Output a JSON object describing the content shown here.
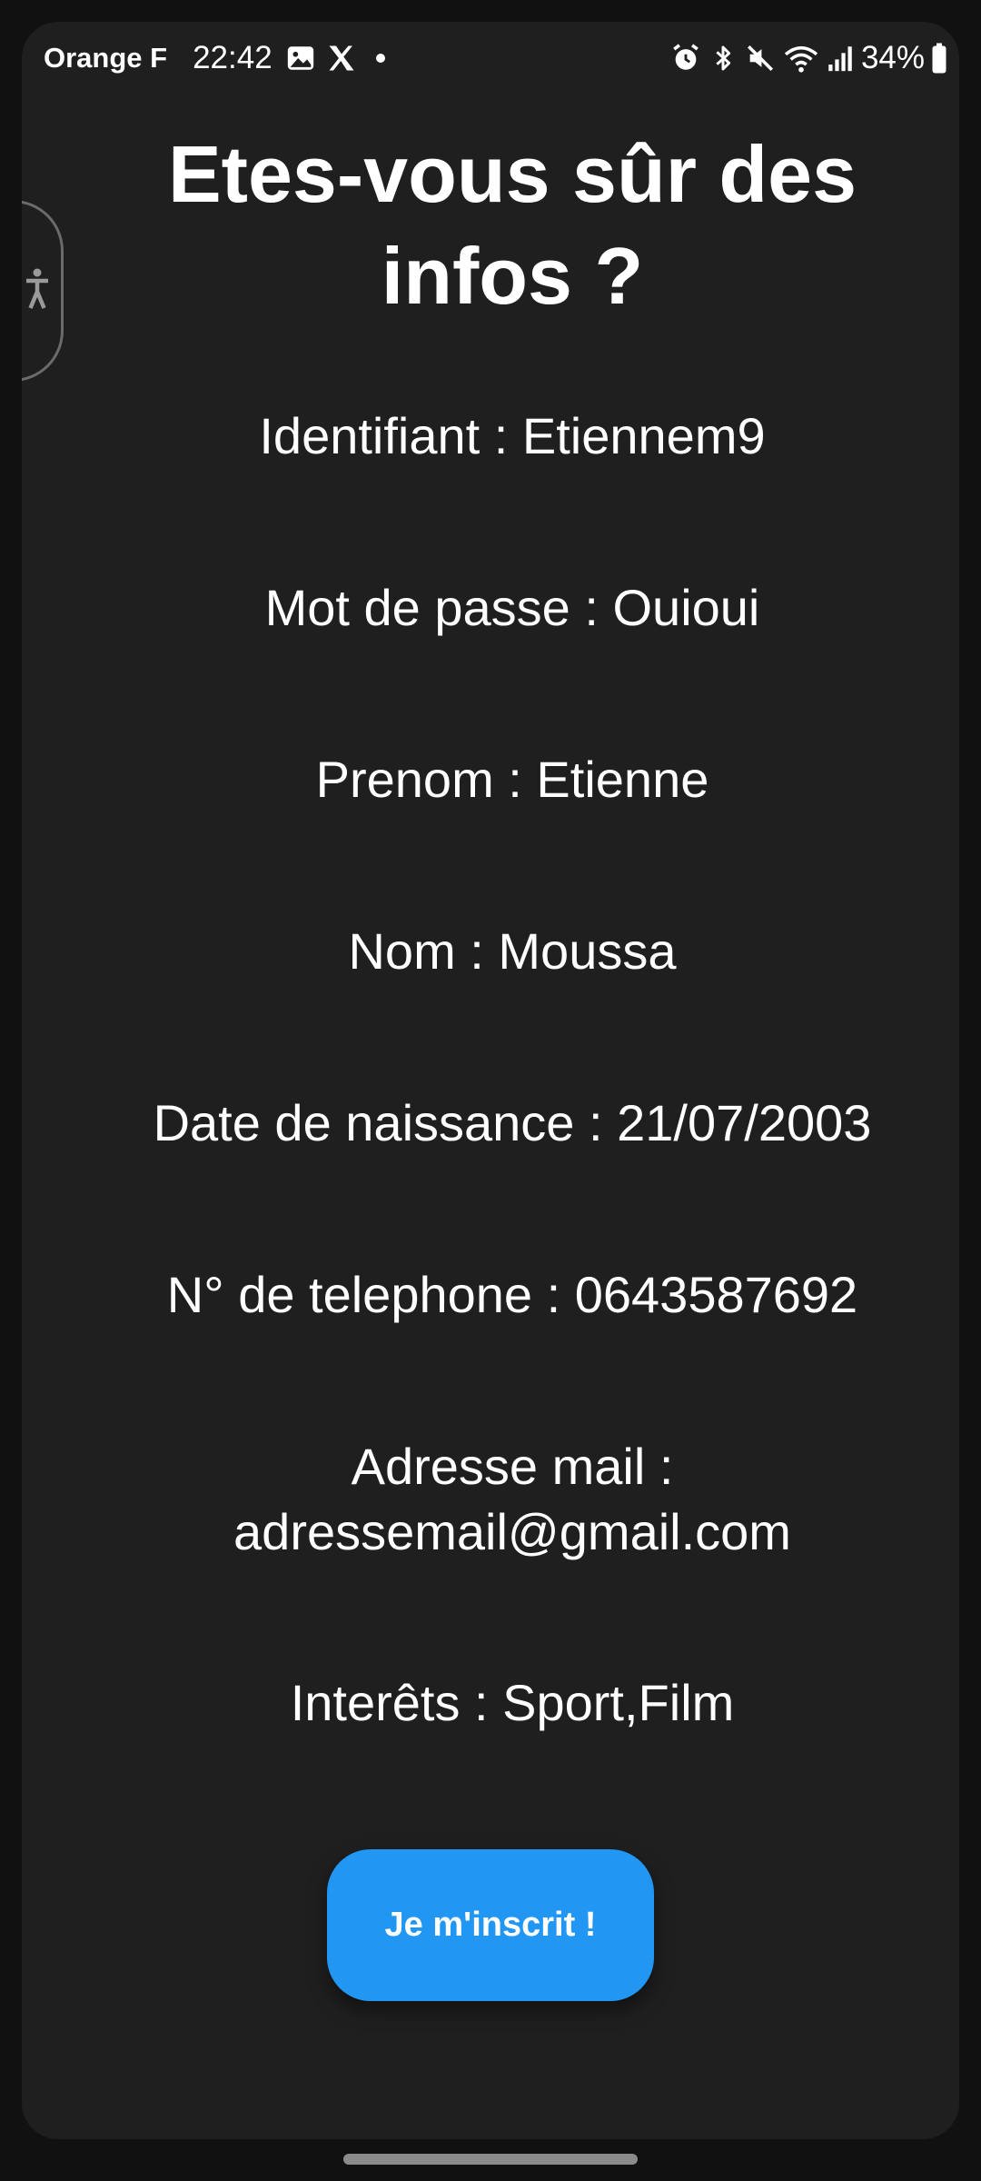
{
  "status_bar": {
    "carrier": "Orange F",
    "time": "22:42",
    "battery_percent": "34%",
    "left_icons": [
      "image-icon",
      "x-logo-icon",
      "notification-dot-icon"
    ],
    "right_icons": [
      "alarm-icon",
      "bluetooth-icon",
      "mute-icon",
      "wifi-icon",
      "signal-icon",
      "battery-icon"
    ]
  },
  "page": {
    "title": "Etes-vous sûr des infos ?"
  },
  "fields": [
    {
      "label": "Identifiant",
      "value": "Etiennem9"
    },
    {
      "label": "Mot de passe",
      "value": "Ouioui"
    },
    {
      "label": "Prenom",
      "value": "Etienne"
    },
    {
      "label": "Nom",
      "value": "Moussa"
    },
    {
      "label": "Date de naissance",
      "value": "21/07/2003"
    },
    {
      "label": "N° de telephone",
      "value": "0643587692"
    },
    {
      "label": "Adresse mail",
      "value": "adressemail@gmail.com"
    },
    {
      "label": "Interêts",
      "value": "Sport,Film"
    }
  ],
  "actions": {
    "submit_label": "Je m'inscrit !"
  },
  "colors": {
    "background": "#1f1f20",
    "accent": "#2196f3",
    "text": "#ffffff"
  }
}
